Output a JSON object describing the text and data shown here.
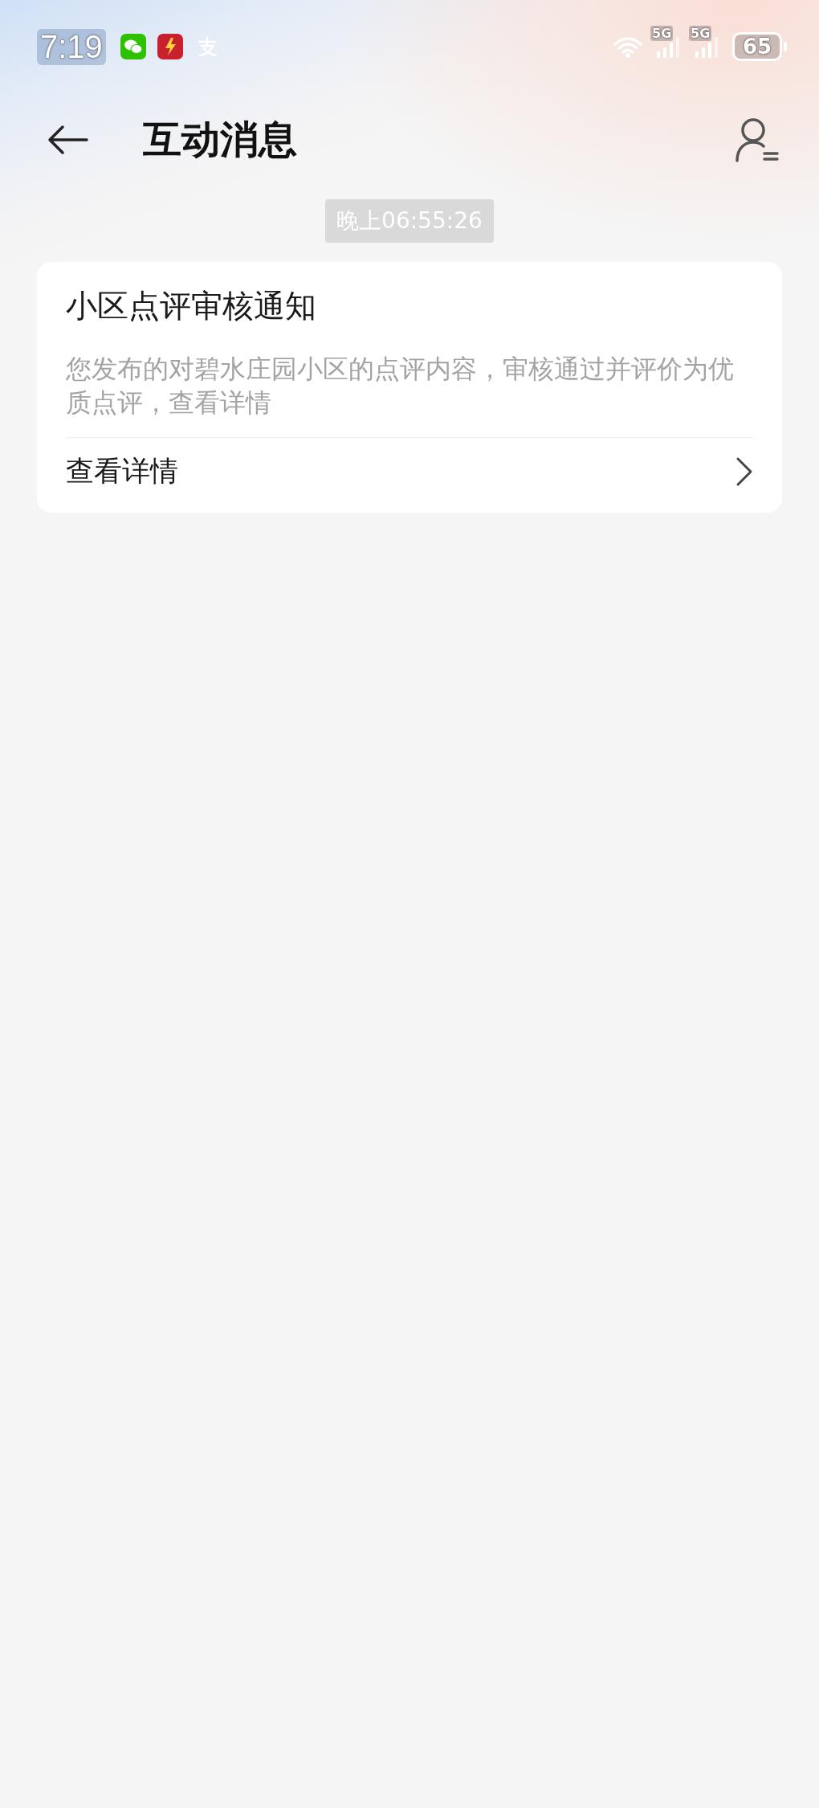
{
  "status_bar": {
    "time": "7:19",
    "network_1": "5G",
    "network_2": "5G",
    "battery": "65"
  },
  "header": {
    "title": "互动消息"
  },
  "messages": [
    {
      "timestamp": "晚上06:55:26",
      "title": "小区点评审核通知",
      "body": "您发布的对碧水庄园小区的点评内容，审核通过并评价为优质点评，查看详情",
      "action": "查看详情"
    }
  ]
}
